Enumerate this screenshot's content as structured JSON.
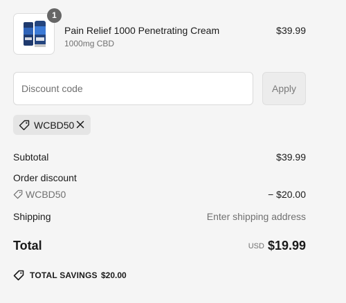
{
  "product": {
    "quantity": "1",
    "name": "Pain Relief 1000 Penetrating Cream",
    "variant": "1000mg CBD",
    "price": "$39.99"
  },
  "discount_form": {
    "placeholder": "Discount code",
    "apply_label": "Apply"
  },
  "applied_code": {
    "code": "WCBD50"
  },
  "summary": {
    "subtotal_label": "Subtotal",
    "subtotal_value": "$39.99",
    "order_discount_label": "Order discount",
    "discount_code": "WCBD50",
    "discount_value": "− $20.00",
    "shipping_label": "Shipping",
    "shipping_value": "Enter shipping address",
    "total_label": "Total",
    "currency": "USD",
    "total_value": "$19.99",
    "savings_label": "TOTAL SAVINGS",
    "savings_value": "$20.00"
  },
  "colors": {
    "background": "#f5f5f5",
    "text": "#1a1a1a",
    "muted_text": "#707070",
    "badge": "#666666",
    "chip": "#e5e5e5",
    "button_disabled": "#ececec"
  },
  "icons": [
    "tag-icon",
    "close-icon"
  ]
}
